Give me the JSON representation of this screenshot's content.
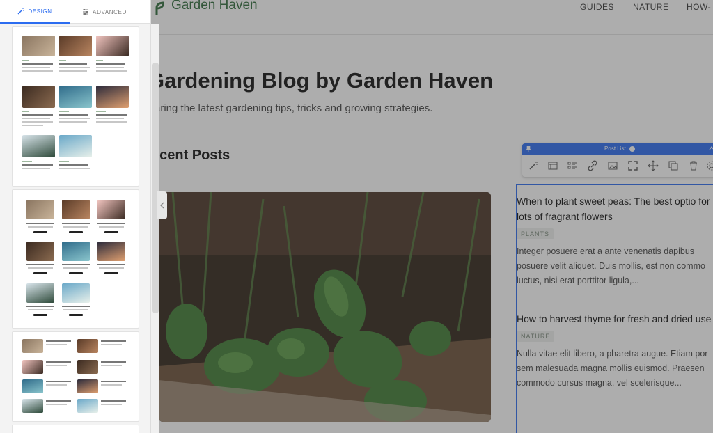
{
  "panel": {
    "tabs": [
      {
        "label": "DESIGN",
        "icon": "magic-wand-icon",
        "active": true
      },
      {
        "label": "ADVANCED",
        "icon": "sliders-icon",
        "active": false
      }
    ],
    "layout_options": [
      "grid-3-column",
      "grid-3-column-with-button",
      "list-2-column",
      "grid-collapsed"
    ]
  },
  "site": {
    "logo_text": "Garden Haven",
    "nav": [
      "GUIDES",
      "NATURE",
      "HOW-"
    ],
    "hero_title": "Gardening Blog by Garden Haven",
    "hero_subtitle": "aring the latest gardening tips, tricks and growing strategies.",
    "section_title": "ecent Posts",
    "posts": [
      {
        "title": "When to plant sweet peas: The best optio for lots of fragrant flowers",
        "tag": "PLANTS",
        "excerpt": "Integer posuere erat a ante venenatis dapibus posuere velit aliquet. Duis mollis, est non commo luctus, nisi erat porttitor ligula,..."
      },
      {
        "title": "How to harvest thyme for fresh and dried use",
        "tag": "NATURE",
        "excerpt": "Nulla vitae elit libero, a pharetra augue. Etiam por sem malesuada magna mollis euismod. Praesen commodo cursus magna, vel scelerisque..."
      }
    ]
  },
  "element_toolbar": {
    "title": "Post List",
    "tools": [
      "magic-wand-icon",
      "layout-icon",
      "list-icon",
      "link-icon",
      "image-icon",
      "fullscreen-icon",
      "move-icon",
      "duplicate-icon",
      "trash-icon",
      "settings-icon"
    ],
    "accent": "#2b6cf0"
  },
  "colors": {
    "accent": "#2b6cf0",
    "brand": "#2e6b3a"
  }
}
